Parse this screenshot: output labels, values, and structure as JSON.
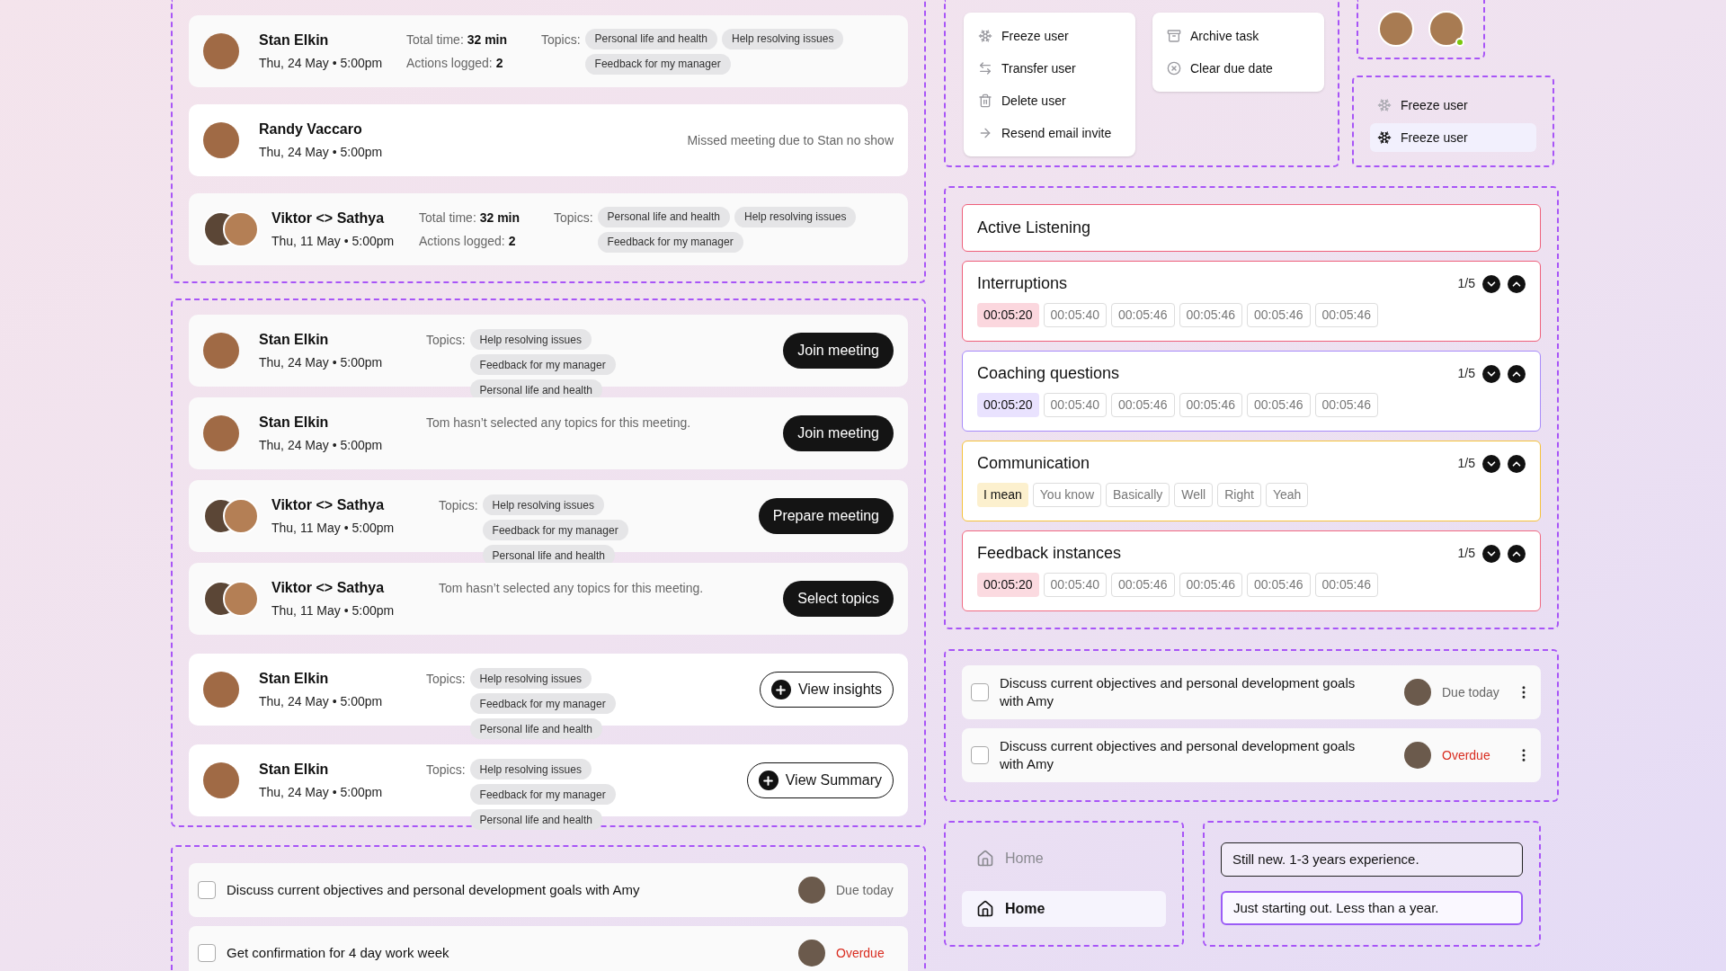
{
  "past_meetings": [
    {
      "kind": "stats",
      "name": "Stan Elkin",
      "pair": false,
      "date": "Thu, 24 May • 5:00pm",
      "time_label": "Total time:",
      "time": "32 min",
      "actions_label": "Actions logged:",
      "actions": "2",
      "topics_label": "Topics:",
      "topics": [
        "Personal life and health",
        "Help resolving issues",
        "Feedback for my manager"
      ]
    },
    {
      "kind": "missed",
      "name": "Randy Vaccaro",
      "pair": false,
      "date": "Thu, 24 May • 5:00pm",
      "note": "Missed meeting due to Stan no show"
    },
    {
      "kind": "stats",
      "name": "Viktor <> Sathya",
      "pair": true,
      "date": "Thu, 11 May • 5:00pm",
      "time_label": "Total time:",
      "time": "32 min",
      "actions_label": "Actions logged:",
      "actions": "2",
      "topics_label": "Topics:",
      "topics": [
        "Personal life and health",
        "Help resolving issues",
        "Feedback for my manager"
      ]
    }
  ],
  "upcoming_meetings": [
    {
      "name": "Stan Elkin",
      "pair": false,
      "date": "Thu, 24 May • 5:00pm",
      "topics_label": "Topics:",
      "topics": [
        "Help resolving issues",
        "Feedback for my manager",
        "Personal life and health"
      ],
      "button": {
        "label": "Join meeting",
        "kind": "solid"
      }
    },
    {
      "name": "Stan Elkin",
      "pair": false,
      "date": "Thu, 24 May • 5:00pm",
      "note": "Tom hasn’t selected any topics for this meeting.",
      "button": {
        "label": "Join meeting",
        "kind": "solid"
      }
    },
    {
      "name": "Viktor <> Sathya",
      "pair": true,
      "date": "Thu, 11 May • 5:00pm",
      "topics_label": "Topics:",
      "topics": [
        "Help resolving issues",
        "Feedback for my manager",
        "Personal life and health"
      ],
      "button": {
        "label": "Prepare meeting",
        "kind": "solid"
      }
    },
    {
      "name": "Viktor <> Sathya",
      "pair": true,
      "date": "Thu, 11 May • 5:00pm",
      "note": "Tom hasn’t selected any topics for this meeting.",
      "button": {
        "label": "Select topics",
        "kind": "solid"
      }
    },
    {
      "name": "Stan Elkin",
      "pair": false,
      "date": "Thu, 24 May • 5:00pm",
      "topics_label": "Topics:",
      "topics": [
        "Help resolving issues",
        "Feedback for my manager",
        "Personal life and health"
      ],
      "button": {
        "label": "View insights",
        "kind": "outline"
      }
    },
    {
      "name": "Stan Elkin",
      "pair": false,
      "date": "Thu, 24 May • 5:00pm",
      "topics_label": "Topics:",
      "topics": [
        "Help resolving issues",
        "Feedback for my manager",
        "Personal life and health"
      ],
      "button": {
        "label": "View Summary",
        "kind": "outline"
      }
    }
  ],
  "tasks_wide": [
    {
      "text": "Discuss current objectives and personal development goals with Amy",
      "checked": false,
      "status": "Due today",
      "overdue": false
    },
    {
      "text": "Get confirmation for 4 day work week",
      "checked": false,
      "status": "Overdue",
      "overdue": true
    }
  ],
  "user_menu": [
    {
      "label": "Freeze user"
    },
    {
      "label": "Transfer user"
    },
    {
      "label": "Delete user"
    },
    {
      "label": "Resend email invite"
    }
  ],
  "task_menu": [
    {
      "label": "Archive task"
    },
    {
      "label": "Clear due date"
    }
  ],
  "avatars": [
    {
      "online": false
    },
    {
      "online": true
    }
  ],
  "freeze_items": [
    {
      "label": "Freeze user",
      "selected": false
    },
    {
      "label": "Freeze user",
      "selected": true
    }
  ],
  "active_listening": {
    "title": "Active Listening",
    "sections": [
      {
        "title": "Interruptions",
        "counter": "1/5",
        "color": "#ee5f7a",
        "chips": [
          {
            "label": "00:05:20",
            "selected": true
          },
          {
            "label": "00:05:40",
            "selected": false
          },
          {
            "label": "00:05:46",
            "selected": false
          },
          {
            "label": "00:05:46",
            "selected": false
          },
          {
            "label": "00:05:46",
            "selected": false
          },
          {
            "label": "00:05:46",
            "selected": false
          }
        ]
      },
      {
        "title": "Coaching questions",
        "counter": "1/5",
        "color": "#a78bfa",
        "chips": [
          {
            "label": "00:05:20",
            "selected": true
          },
          {
            "label": "00:05:40",
            "selected": false
          },
          {
            "label": "00:05:46",
            "selected": false
          },
          {
            "label": "00:05:46",
            "selected": false
          },
          {
            "label": "00:05:46",
            "selected": false
          },
          {
            "label": "00:05:46",
            "selected": false
          }
        ]
      },
      {
        "title": "Communication",
        "counter": "1/5",
        "color": "#f5c23a",
        "chips": [
          {
            "label": "I mean",
            "selected": true
          },
          {
            "label": "You know",
            "selected": false
          },
          {
            "label": "Basically",
            "selected": false
          },
          {
            "label": "Well",
            "selected": false
          },
          {
            "label": "Right",
            "selected": false
          },
          {
            "label": "Yeah",
            "selected": false
          }
        ]
      },
      {
        "title": "Feedback instances",
        "counter": "1/5",
        "color": "#f06a82",
        "chips": [
          {
            "label": "00:05:20",
            "selected": true
          },
          {
            "label": "00:05:40",
            "selected": false
          },
          {
            "label": "00:05:46",
            "selected": false
          },
          {
            "label": "00:05:46",
            "selected": false
          },
          {
            "label": "00:05:46",
            "selected": false
          },
          {
            "label": "00:05:46",
            "selected": false
          }
        ]
      }
    ]
  },
  "tasks_compact": [
    {
      "text": "Discuss current objectives and personal development goals with Amy",
      "checked": false,
      "status": "Due today",
      "overdue": false
    },
    {
      "text": "Discuss current objectives and personal development goals with Amy",
      "checked": false,
      "status": "Overdue",
      "overdue": true
    }
  ],
  "nav_items": [
    {
      "label": "Home",
      "selected": false
    },
    {
      "label": "Home",
      "selected": true
    }
  ],
  "experience_options": [
    {
      "label": "Still new. 1-3 years experience.",
      "selected": false
    },
    {
      "label": "Just starting out. Less than a year.",
      "selected": true
    }
  ]
}
